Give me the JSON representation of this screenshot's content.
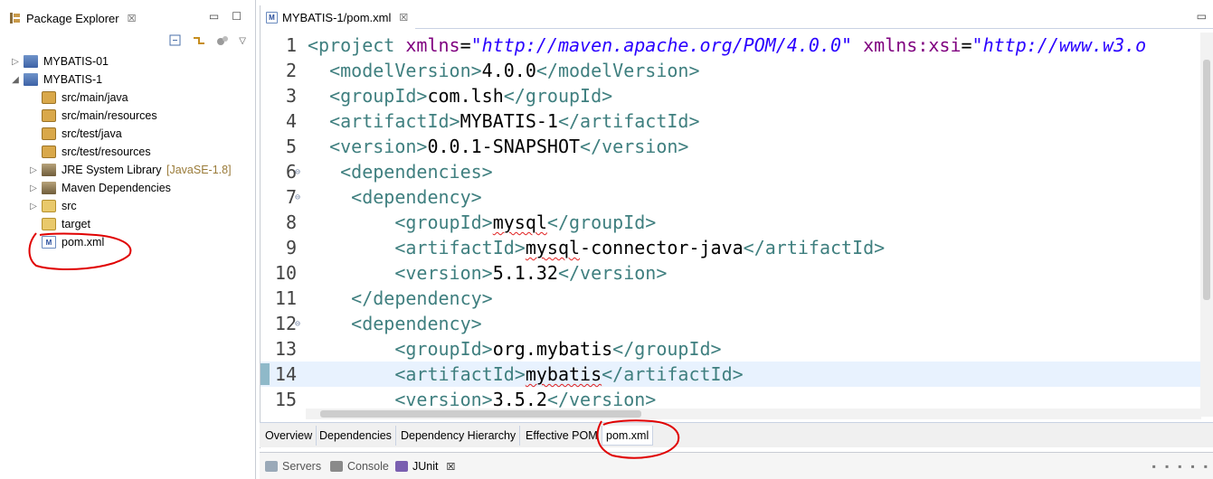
{
  "package_explorer": {
    "title": "Package Explorer",
    "tree": [
      {
        "label": "MYBATIS-01",
        "decoration": "",
        "icon": "maven-project-icon",
        "depth": 0,
        "arrow": "▷"
      },
      {
        "label": "MYBATIS-1",
        "decoration": "",
        "icon": "maven-project-icon",
        "depth": 0,
        "arrow": "◢"
      },
      {
        "label": "src/main/java",
        "decoration": "",
        "icon": "source-folder-icon",
        "depth": 1,
        "arrow": ""
      },
      {
        "label": "src/main/resources",
        "decoration": "",
        "icon": "source-folder-icon",
        "depth": 1,
        "arrow": ""
      },
      {
        "label": "src/test/java",
        "decoration": "",
        "icon": "source-folder-icon",
        "depth": 1,
        "arrow": ""
      },
      {
        "label": "src/test/resources",
        "decoration": "",
        "icon": "source-folder-icon",
        "depth": 1,
        "arrow": ""
      },
      {
        "label": "JRE System Library",
        "decoration": "[JavaSE-1.8]",
        "icon": "library-icon",
        "depth": 1,
        "arrow": "▷"
      },
      {
        "label": "Maven Dependencies",
        "decoration": "",
        "icon": "library-icon",
        "depth": 1,
        "arrow": "▷"
      },
      {
        "label": "src",
        "decoration": "",
        "icon": "folder-icon",
        "depth": 1,
        "arrow": "▷"
      },
      {
        "label": "target",
        "decoration": "",
        "icon": "folder-icon",
        "depth": 1,
        "arrow": ""
      },
      {
        "label": "pom.xml",
        "decoration": "",
        "icon": "pom-file-icon",
        "depth": 1,
        "arrow": ""
      }
    ]
  },
  "editor": {
    "tab_label": "MYBATIS-1/pom.xml",
    "highlighted_line": 14,
    "lines": [
      {
        "n": "1",
        "fold": "",
        "tokens": [
          {
            "t": "<",
            "c": "tg"
          },
          {
            "t": "project",
            "c": "tg"
          },
          {
            "t": " xmlns",
            "c": "at"
          },
          {
            "t": "=",
            "c": ""
          },
          {
            "t": "\"http://maven.apache.org/POM/4.0.0\"",
            "c": "av"
          },
          {
            "t": " xmlns:xsi",
            "c": "at"
          },
          {
            "t": "=",
            "c": ""
          },
          {
            "t": "\"http://www.w3.o",
            "c": "av"
          }
        ]
      },
      {
        "n": "2",
        "fold": "",
        "tokens": [
          {
            "t": "  <modelVersion>",
            "c": "tg"
          },
          {
            "t": "4.0.0",
            "c": ""
          },
          {
            "t": "</modelVersion>",
            "c": "tg"
          }
        ]
      },
      {
        "n": "3",
        "fold": "",
        "tokens": [
          {
            "t": "  <groupId>",
            "c": "tg"
          },
          {
            "t": "com.lsh",
            "c": ""
          },
          {
            "t": "</groupId>",
            "c": "tg"
          }
        ]
      },
      {
        "n": "4",
        "fold": "",
        "tokens": [
          {
            "t": "  <artifactId>",
            "c": "tg"
          },
          {
            "t": "MYBATIS-1",
            "c": ""
          },
          {
            "t": "</artifactId>",
            "c": "tg"
          }
        ]
      },
      {
        "n": "5",
        "fold": "",
        "tokens": [
          {
            "t": "  <version>",
            "c": "tg"
          },
          {
            "t": "0.0.1-SNAPSHOT",
            "c": ""
          },
          {
            "t": "</version>",
            "c": "tg"
          }
        ]
      },
      {
        "n": "6",
        "fold": "⊖",
        "tokens": [
          {
            "t": "   <dependencies>",
            "c": "tg"
          }
        ]
      },
      {
        "n": "7",
        "fold": "⊖",
        "tokens": [
          {
            "t": "    <dependency>",
            "c": "tg"
          }
        ]
      },
      {
        "n": "8",
        "fold": "",
        "tokens": [
          {
            "t": "        <groupId>",
            "c": "tg"
          },
          {
            "t": "mysql",
            "c": "sq"
          },
          {
            "t": "</groupId>",
            "c": "tg"
          }
        ]
      },
      {
        "n": "9",
        "fold": "",
        "tokens": [
          {
            "t": "        <artifactId>",
            "c": "tg"
          },
          {
            "t": "mysql",
            "c": "sq"
          },
          {
            "t": "-connector-java",
            "c": ""
          },
          {
            "t": "</artifactId>",
            "c": "tg"
          }
        ]
      },
      {
        "n": "10",
        "fold": "",
        "tokens": [
          {
            "t": "        <version>",
            "c": "tg"
          },
          {
            "t": "5.1.32",
            "c": ""
          },
          {
            "t": "</version>",
            "c": "tg"
          }
        ]
      },
      {
        "n": "11",
        "fold": "",
        "tokens": [
          {
            "t": "    </dependency>",
            "c": "tg"
          }
        ]
      },
      {
        "n": "12",
        "fold": "⊖",
        "tokens": [
          {
            "t": "    <dependency>",
            "c": "tg"
          }
        ]
      },
      {
        "n": "13",
        "fold": "",
        "tokens": [
          {
            "t": "        <groupId>",
            "c": "tg"
          },
          {
            "t": "org.mybatis",
            "c": ""
          },
          {
            "t": "</groupId>",
            "c": "tg"
          }
        ]
      },
      {
        "n": "14",
        "fold": "",
        "tokens": [
          {
            "t": "        <artifactId>",
            "c": "tg"
          },
          {
            "t": "mybatis",
            "c": "sq"
          },
          {
            "t": "</artifactId>",
            "c": "tg"
          }
        ]
      },
      {
        "n": "15",
        "fold": "",
        "tokens": [
          {
            "t": "        <version>",
            "c": "tg"
          },
          {
            "t": "3.5.2",
            "c": ""
          },
          {
            "t": "</version>",
            "c": "tg"
          }
        ]
      }
    ]
  },
  "pom_editor_tabs": [
    {
      "label": "Overview",
      "active": false
    },
    {
      "label": "Dependencies",
      "active": false
    },
    {
      "label": "Dependency Hierarchy",
      "active": false
    },
    {
      "label": "Effective POM",
      "active": false
    },
    {
      "label": "pom.xml",
      "active": true
    }
  ],
  "bottom_views": [
    {
      "label": "Servers",
      "active": false,
      "icon": "servers-icon"
    },
    {
      "label": "Console",
      "active": false,
      "icon": "console-icon"
    },
    {
      "label": "JUnit",
      "active": true,
      "icon": "junit-icon"
    }
  ],
  "colors": {
    "xml_tag": "#3f7f7f",
    "xml_attribute": "#7f007f",
    "xml_attribute_value": "#2a00ff",
    "current_line": "#e8f2fe",
    "annotation": "#e00000"
  }
}
